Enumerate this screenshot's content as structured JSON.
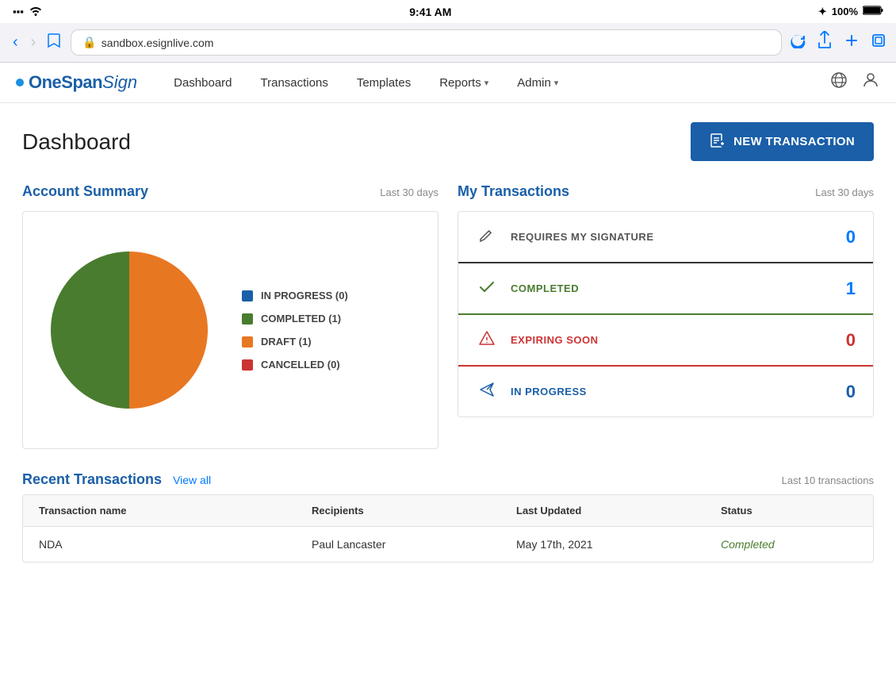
{
  "statusBar": {
    "time": "9:41 AM",
    "battery": "100%",
    "signal": "●●●●"
  },
  "browserBar": {
    "url": "sandbox.esignlive.com",
    "lockIcon": "🔒"
  },
  "nav": {
    "logoText1": "OneSpan",
    "logoText2": "Sign",
    "links": [
      {
        "label": "Dashboard",
        "dropdown": false
      },
      {
        "label": "Transactions",
        "dropdown": false
      },
      {
        "label": "Templates",
        "dropdown": false
      },
      {
        "label": "Reports",
        "dropdown": true
      },
      {
        "label": "Admin",
        "dropdown": true
      }
    ]
  },
  "dashboard": {
    "title": "Dashboard",
    "newTransactionBtn": "NEW TRANSACTION"
  },
  "accountSummary": {
    "title": "Account Summary",
    "meta": "Last 30 days",
    "legend": [
      {
        "label": "IN PROGRESS (0)",
        "color": "#1a5fa8"
      },
      {
        "label": "COMPLETED (1)",
        "color": "#4a7c2f"
      },
      {
        "label": "DRAFT (1)",
        "color": "#e87722"
      },
      {
        "label": "CANCELLED (0)",
        "color": "#cc3333"
      }
    ],
    "pieData": [
      {
        "label": "IN PROGRESS",
        "value": 0,
        "color": "#1a5fa8"
      },
      {
        "label": "COMPLETED",
        "value": 1,
        "color": "#4a7c2f"
      },
      {
        "label": "DRAFT",
        "value": 1,
        "color": "#e87722"
      },
      {
        "label": "CANCELLED",
        "value": 0,
        "color": "#cc3333"
      }
    ]
  },
  "myTransactions": {
    "title": "My Transactions",
    "meta": "Last 30 days",
    "rows": [
      {
        "id": "requires",
        "label": "REQUIRES MY SIGNATURE",
        "count": "0",
        "iconType": "pencil"
      },
      {
        "id": "completed",
        "label": "COMPLETED",
        "count": "1",
        "iconType": "check"
      },
      {
        "id": "expiring",
        "label": "EXPIRING SOON",
        "count": "0",
        "iconType": "warning"
      },
      {
        "id": "inprogress",
        "label": "IN PROGRESS",
        "count": "0",
        "iconType": "send"
      }
    ]
  },
  "recentTransactions": {
    "title": "Recent Transactions",
    "viewAll": "View all",
    "meta": "Last 10 transactions",
    "columns": [
      "Transaction name",
      "Recipients",
      "Last Updated",
      "Status"
    ],
    "rows": [
      {
        "name": "NDA",
        "recipients": "Paul Lancaster",
        "updated": "May 17th, 2021",
        "status": "Completed"
      }
    ]
  }
}
